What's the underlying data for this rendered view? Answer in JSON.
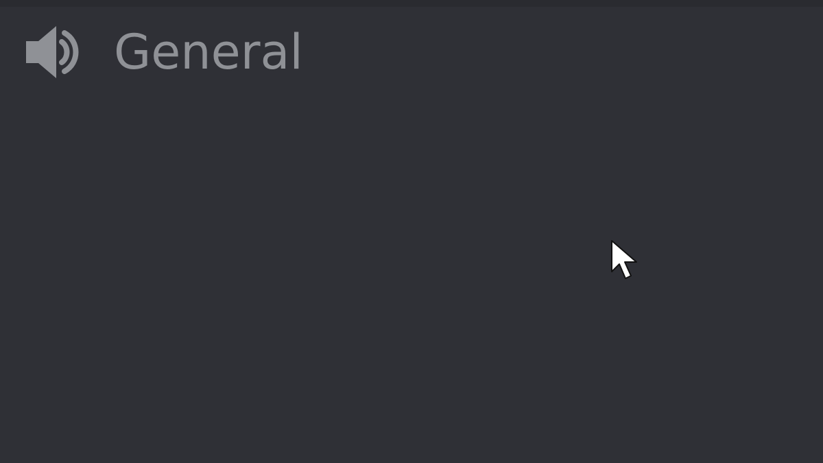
{
  "voice_channel": {
    "icon": "speaker-icon",
    "name": "General"
  },
  "colors": {
    "background": "#2f3036",
    "channel_text": "#8f9196",
    "cursor": "#ffffff"
  }
}
